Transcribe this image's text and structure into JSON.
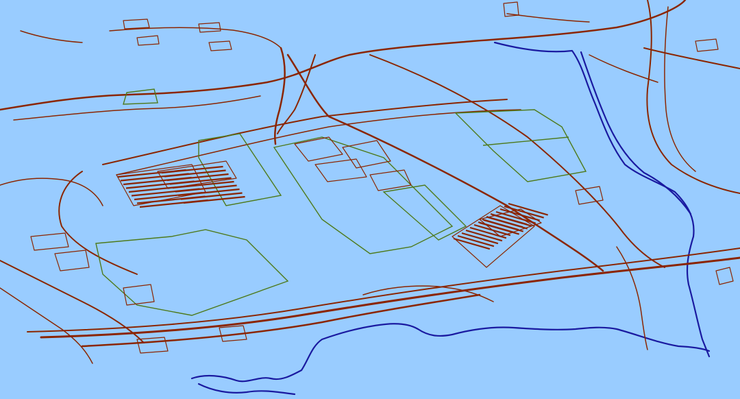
{
  "map": {
    "view": "oblique-3d-vector",
    "background_color": "#99CCFF",
    "road_color": "#8B2500",
    "building_color": "#8B2500",
    "landuse_color": "#4E7A1A",
    "water_color": "#1A1AA0",
    "labels": []
  }
}
